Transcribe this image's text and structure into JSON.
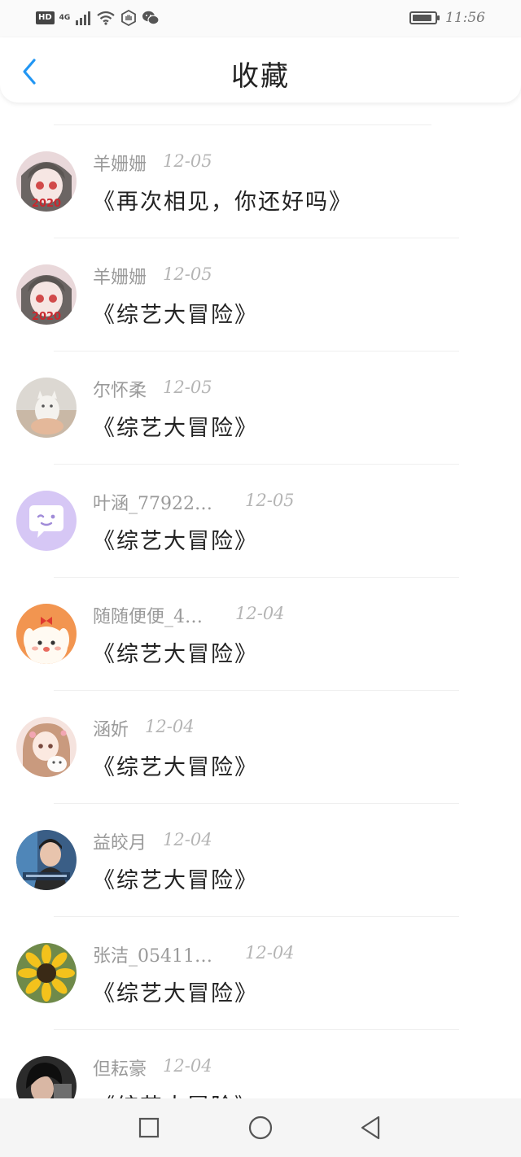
{
  "status_bar": {
    "network_badge": "HD",
    "network_type": "4G",
    "time": "11:56",
    "battery_level": 0.9
  },
  "header": {
    "title": "收藏",
    "back_icon": "chevron-left-icon",
    "accent_color": "#2196F3"
  },
  "favorites": [
    {
      "author": "羊姗姗",
      "date": "12-05",
      "title": "《再次相见，你还好吗》",
      "avatar": "anime-girl-avatar"
    },
    {
      "author": "羊姗姗",
      "date": "12-05",
      "title": "《综艺大冒险》",
      "avatar": "anime-girl-avatar"
    },
    {
      "author": "尔怀柔",
      "date": "12-05",
      "title": "《综艺大冒险》",
      "avatar": "cat-photo-avatar"
    },
    {
      "author": "叶涵_77922…",
      "date": "12-05",
      "title": "《综艺大冒险》",
      "avatar": "chat-bubble-avatar"
    },
    {
      "author": "随随便便_4…",
      "date": "12-04",
      "title": "《综艺大冒险》",
      "avatar": "cartoon-bunny-avatar"
    },
    {
      "author": "涵妡",
      "date": "12-04",
      "title": "《综艺大冒险》",
      "avatar": "illustrated-girl-avatar"
    },
    {
      "author": "益皎月",
      "date": "12-04",
      "title": "《综艺大冒险》",
      "avatar": "photo-person-avatar"
    },
    {
      "author": "张洁_05411…",
      "date": "12-04",
      "title": "《综艺大冒险》",
      "avatar": "sunflower-avatar"
    },
    {
      "author": "但耘豪",
      "date": "12-04",
      "title": "《综艺大冒险》",
      "avatar": "dark-portrait-avatar"
    }
  ],
  "nav_bar": {
    "recents_icon": "square-icon",
    "home_icon": "circle-icon",
    "back_icon": "triangle-back-icon"
  }
}
